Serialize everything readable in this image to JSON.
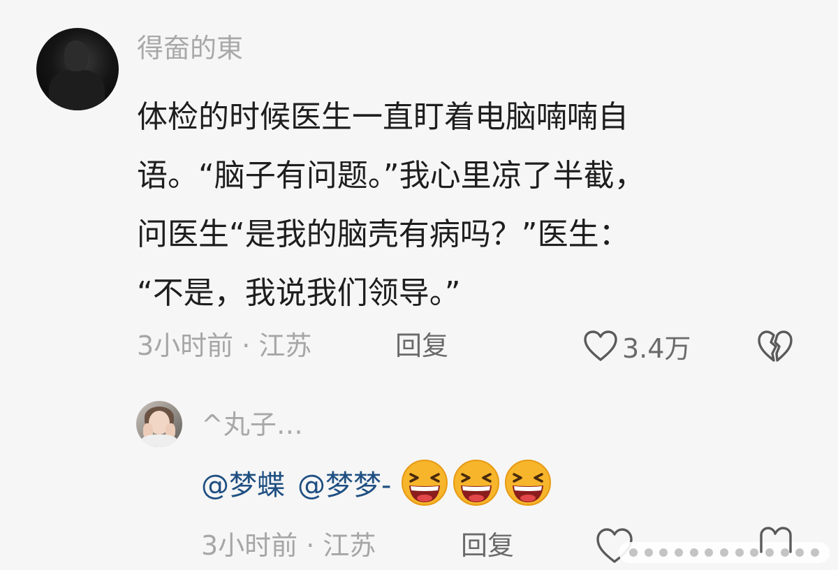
{
  "comment": {
    "username": "得奤的東",
    "lines": [
      "体检的时候医生一直盯着电脑喃喃自",
      "语。“脑子有问题。”我心里凉了半截，",
      "问医生“是我的脑壳有病吗？”医生：",
      "“不是，我说我们领导。”"
    ],
    "time_location": "3小时前 · 江苏",
    "reply_label": "回复",
    "like_count": "3.4万",
    "icons": {
      "like": "heart-outline-icon",
      "dislike": "broken-heart-icon",
      "avatar": "profile-avatar"
    }
  },
  "reply": {
    "username": "^丸子…",
    "mentions": [
      "@梦蝶",
      "@梦梦-"
    ],
    "emojis": [
      "laughing-emoji",
      "laughing-emoji",
      "laughing-emoji"
    ],
    "time_location": "3小时前 · 江苏",
    "reply_label": "回复"
  },
  "colors": {
    "background": "#f6f6f6",
    "text": "#1e1e1e",
    "muted": "#a6a6a6",
    "mention": "#1f4f82",
    "emoji_face": "#f6b52a"
  }
}
